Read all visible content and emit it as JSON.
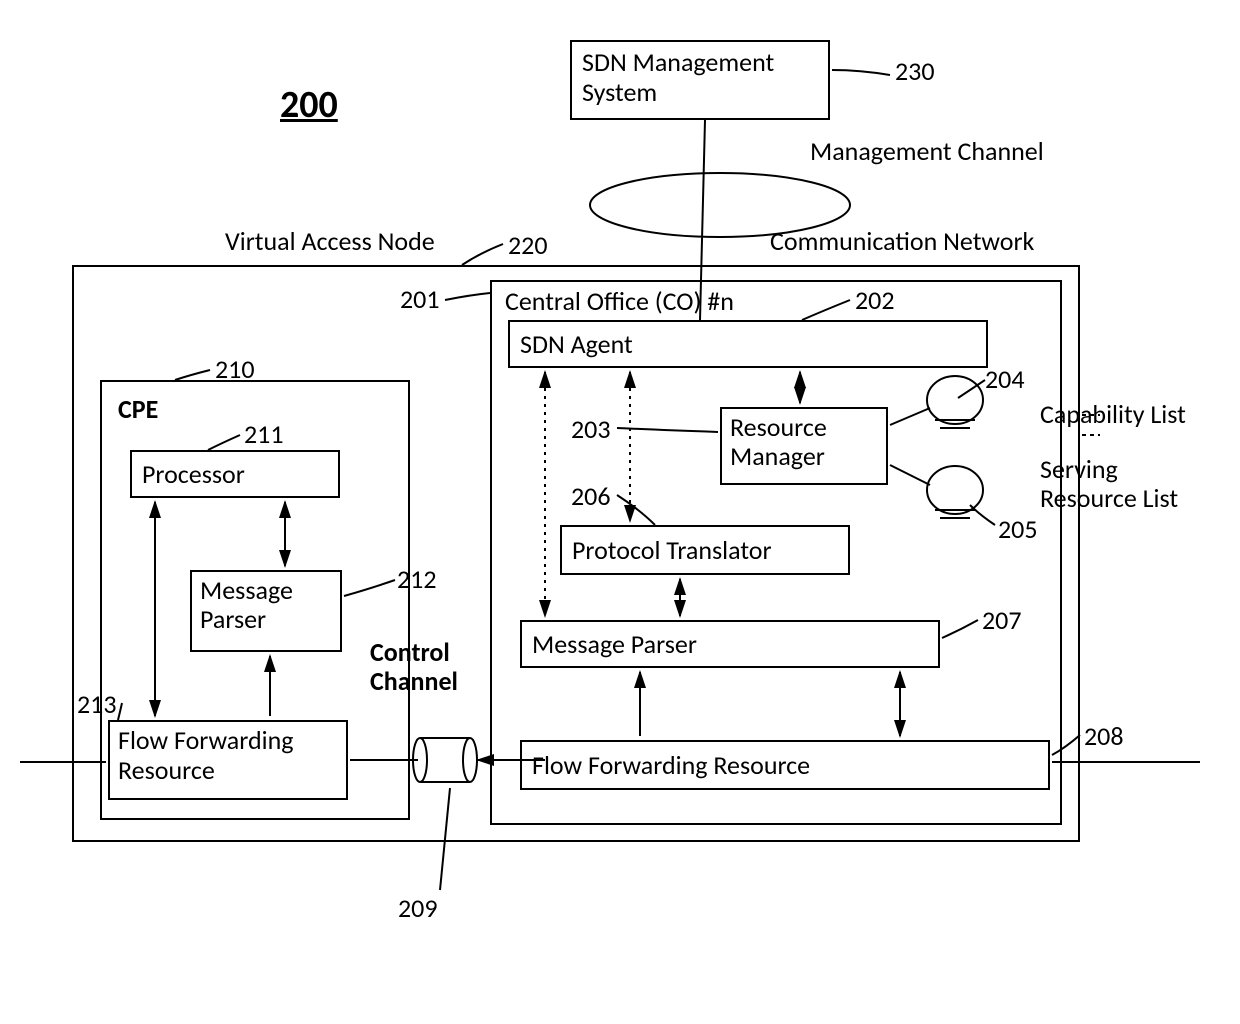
{
  "figureNumber": "200",
  "topLabels": {
    "virtualAccessNode": "Virtual Access Node",
    "communicationNetwork": "Communication Network",
    "managementChannel": "Management Channel",
    "controlChannel": "Control Channel"
  },
  "refs": {
    "sdnMgmt": "230",
    "van": "220",
    "co": "201",
    "sdnAgent": "202",
    "resMgr": "203",
    "capList": "204",
    "servList": "205",
    "protoTrans": "206",
    "msgParserCO": "207",
    "ffrCO": "208",
    "ctrlChannel": "209",
    "cpe": "210",
    "processor": "211",
    "msgParserCPE": "212",
    "ffrCPE": "213"
  },
  "boxes": {
    "sdnMgmt": "SDN Management System",
    "coTitle": "Central Office (CO) #n",
    "sdnAgent": "SDN Agent",
    "resMgr": "Resource Manager",
    "protoTrans": "Protocol Translator",
    "msgParserCO": "Message Parser",
    "ffrCO": "Flow Forwarding Resource",
    "cpe": "CPE",
    "processor": "Processor",
    "msgParserCPE": "Message Parser",
    "ffrCPE": "Flow Forwarding Resource"
  },
  "sideLabels": {
    "capabilityList": "Capability List",
    "servingResourceList": "Serving Resource List"
  }
}
